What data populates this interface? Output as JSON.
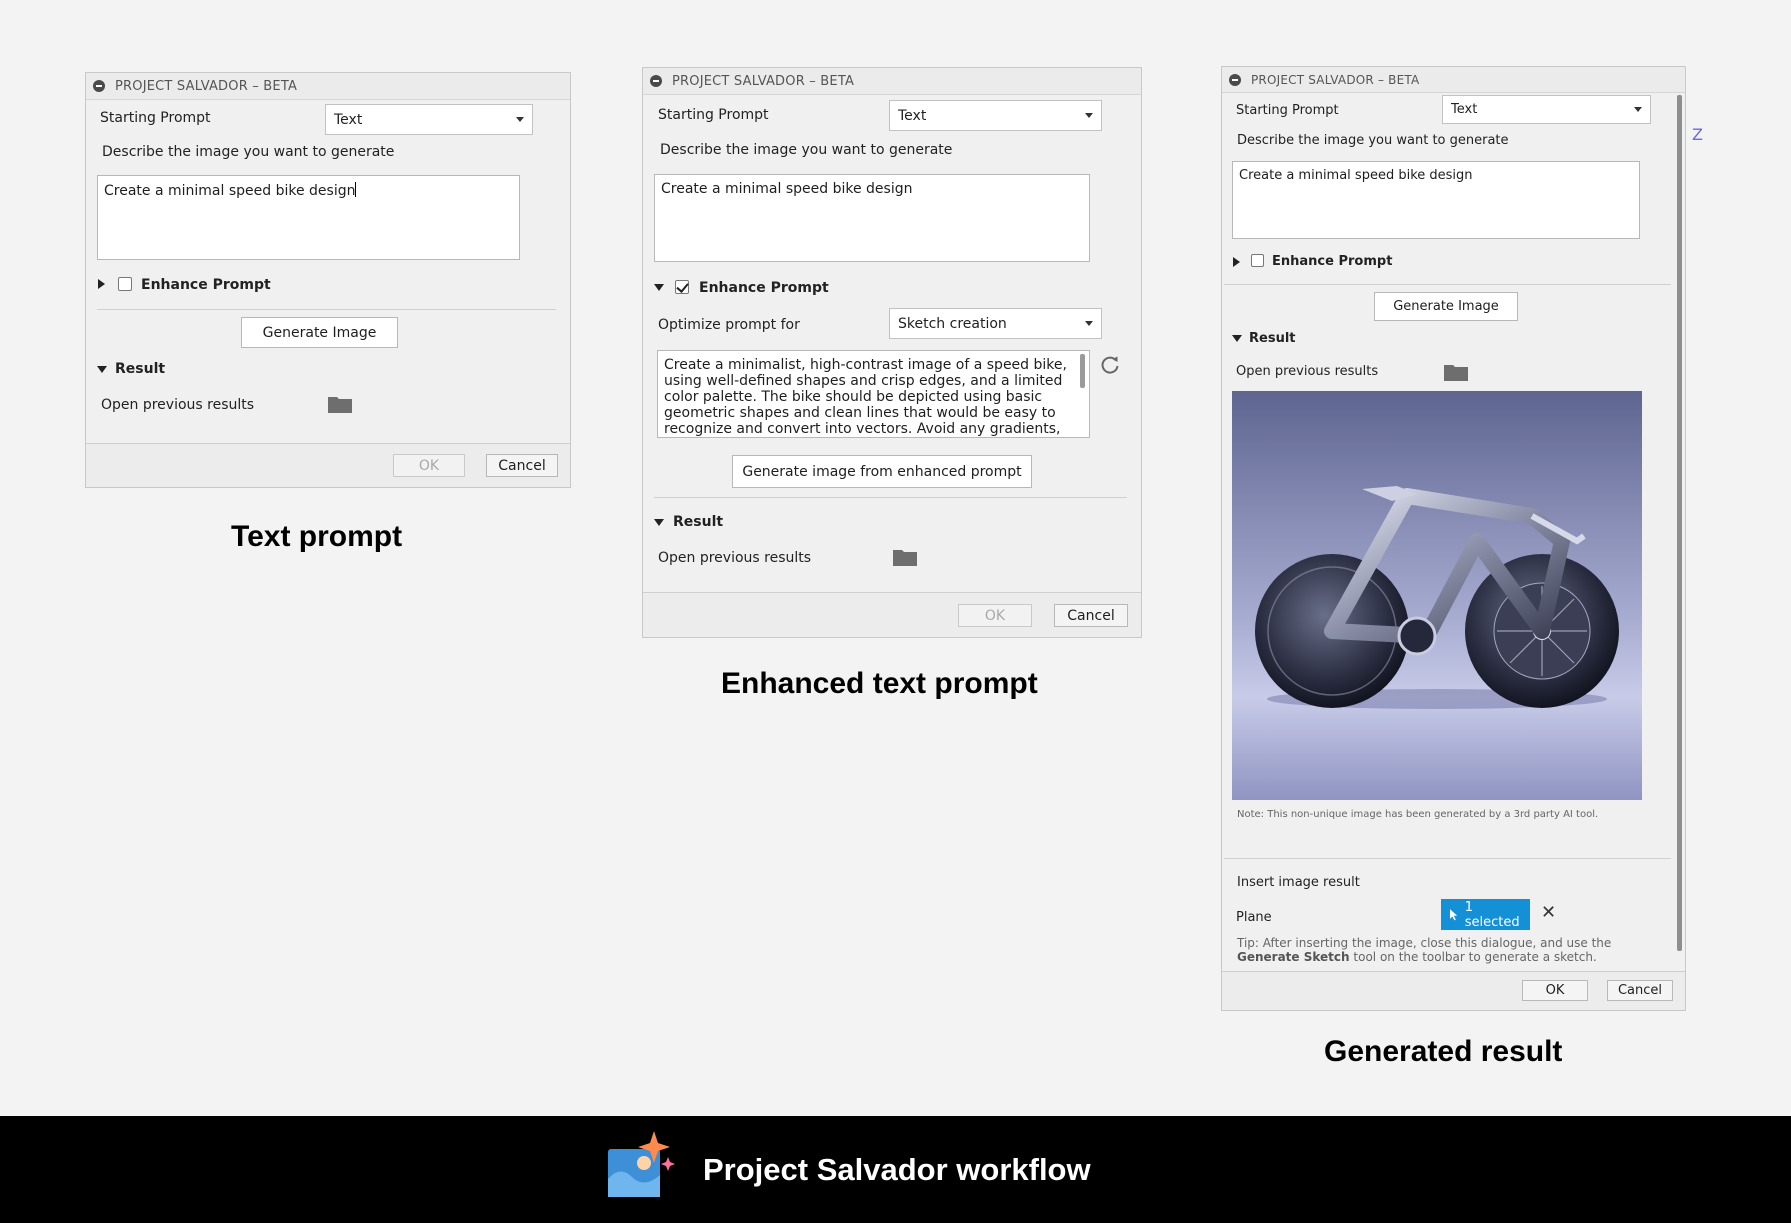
{
  "dialog_title": "PROJECT SALVADOR – BETA",
  "panel1": {
    "starting_prompt_label": "Starting Prompt",
    "starting_prompt_value": "Text",
    "describe_label": "Describe the image you want to generate",
    "prompt_text": "Create a minimal speed bike design",
    "enhance_label": "Enhance Prompt",
    "generate_label": "Generate Image",
    "result_label": "Result",
    "open_prev_label": "Open previous results",
    "ok_label": "OK",
    "cancel_label": "Cancel",
    "caption": "Text prompt"
  },
  "panel2": {
    "starting_prompt_label": "Starting Prompt",
    "starting_prompt_value": "Text",
    "describe_label": "Describe the image you want to generate",
    "prompt_text": "Create a minimal speed bike design",
    "enhance_label": "Enhance Prompt",
    "optimize_label": "Optimize prompt for",
    "optimize_value": "Sketch creation",
    "enhanced_text": "Create a minimalist, high-contrast image of a speed bike, using well-defined shapes and crisp edges, and a limited color palette. The bike should be depicted using basic geometric shapes and clean lines that would be easy to recognize and convert into vectors. Avoid any gradients,",
    "generate_enhanced_label": "Generate image from enhanced prompt",
    "result_label": "Result",
    "open_prev_label": "Open previous results",
    "ok_label": "OK",
    "cancel_label": "Cancel",
    "caption": "Enhanced text prompt"
  },
  "panel3": {
    "starting_prompt_label": "Starting Prompt",
    "starting_prompt_value": "Text",
    "describe_label": "Describe the image you want to generate",
    "prompt_text": "Create a minimal speed bike design",
    "enhance_label": "Enhance Prompt",
    "generate_label": "Generate Image",
    "result_label": "Result",
    "open_prev_label": "Open previous results",
    "note": "Note: This non-unique image has been generated by a 3rd party AI tool.",
    "insert_label": "Insert image result",
    "plane_label": "Plane",
    "selected_label": "1 selected",
    "tip_text": "Tip: After inserting the image, close this dialogue, and use the",
    "tip_bold": "Generate Sketch",
    "tip_rest": "tool on the toolbar to generate a sketch.",
    "ok_label": "OK",
    "cancel_label": "Cancel",
    "caption": "Generated result"
  },
  "stray_marks": [
    "Z"
  ],
  "footer_title": "Project Salvador workflow",
  "icons": [
    "minus-circle-icon",
    "folder-icon",
    "dropdown-arrow-icon",
    "refresh-icon",
    "cursor-icon",
    "close-icon",
    "sparkle-image-logo-icon"
  ],
  "colors": {
    "accent": "#1491d6",
    "background": "#f3f3f3",
    "footer": "#000000"
  }
}
